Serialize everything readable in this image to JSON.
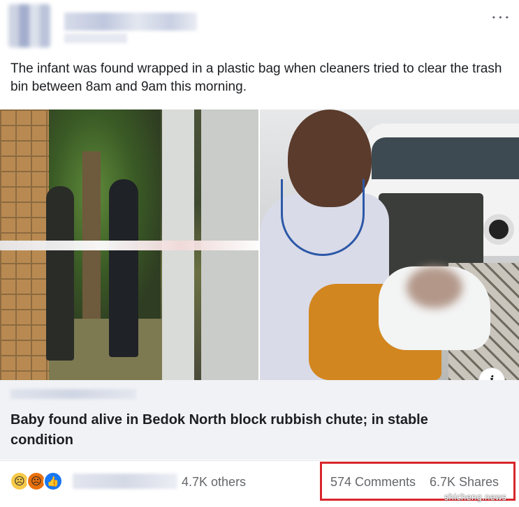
{
  "post": {
    "caption": "The infant was found wrapped in a plastic bag when cleaners tried to clear the trash bin between 8am and 9am this morning.",
    "more_icon": "more-dots-icon"
  },
  "link_preview": {
    "title": "Baby found alive in Bedok North block rubbish chute; in stable condition",
    "info_label": "i",
    "info_icon": "info-icon"
  },
  "reactions": {
    "icons": [
      "sad-reaction-icon",
      "angry-reaction-icon",
      "like-reaction-icon"
    ],
    "others": "4.7K others",
    "comments": "574 Comments",
    "shares": "6.7K Shares",
    "highlight_color": "#d8262b"
  },
  "watermark": "shicheng.news",
  "colors": {
    "link_box_bg": "#f0f2f5",
    "secondary_text": "#65676b",
    "like_blue": "#1877f2"
  }
}
